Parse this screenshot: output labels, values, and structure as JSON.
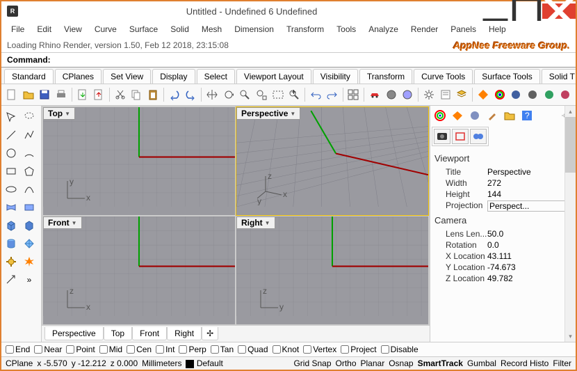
{
  "title": "Untitled - Undefined 6 Undefined",
  "menu": [
    "File",
    "Edit",
    "View",
    "Curve",
    "Surface",
    "Solid",
    "Mesh",
    "Dimension",
    "Transform",
    "Tools",
    "Analyze",
    "Render",
    "Panels",
    "Help"
  ],
  "loading": "Loading Rhino Render, version 1.50, Feb 12 2018, 23:15:08",
  "brand": "AppNee Freeware Group.",
  "command_label": "Command:",
  "tool_tabs": [
    "Standard",
    "CPlanes",
    "Set View",
    "Display",
    "Select",
    "Viewport Layout",
    "Visibility",
    "Transform",
    "Curve Tools",
    "Surface Tools",
    "Solid T"
  ],
  "viewports": {
    "top": "Top",
    "perspective": "Perspective",
    "front": "Front",
    "right": "Right"
  },
  "vp_tabs": [
    "Perspective",
    "Top",
    "Front",
    "Right"
  ],
  "props": {
    "section1": "Viewport",
    "title_label": "Title",
    "title_value": "Perspective",
    "width_label": "Width",
    "width_value": "272",
    "height_label": "Height",
    "height_value": "144",
    "proj_label": "Projection",
    "proj_value": "Perspect...",
    "section2": "Camera",
    "lens_label": "Lens Len...",
    "lens_value": "50.0",
    "rot_label": "Rotation",
    "rot_value": "0.0",
    "xloc_label": "X Location",
    "xloc_value": "43.111",
    "yloc_label": "Y Location",
    "yloc_value": "-74.673",
    "zloc_label": "Z Location",
    "zloc_value": "49.782"
  },
  "osnaps": [
    "End",
    "Near",
    "Point",
    "Mid",
    "Cen",
    "Int",
    "Perp",
    "Tan",
    "Quad",
    "Knot",
    "Vertex",
    "Project",
    "Disable"
  ],
  "status": {
    "cplane": "CPlane",
    "x": "x -5.570",
    "y": "y -12.212",
    "z": "z 0.000",
    "units": "Millimeters",
    "layer": "Default",
    "opts": [
      "Grid Snap",
      "Ortho",
      "Planar",
      "Osnap",
      "SmartTrack",
      "Gumbal",
      "Record Histo",
      "Filter"
    ]
  }
}
